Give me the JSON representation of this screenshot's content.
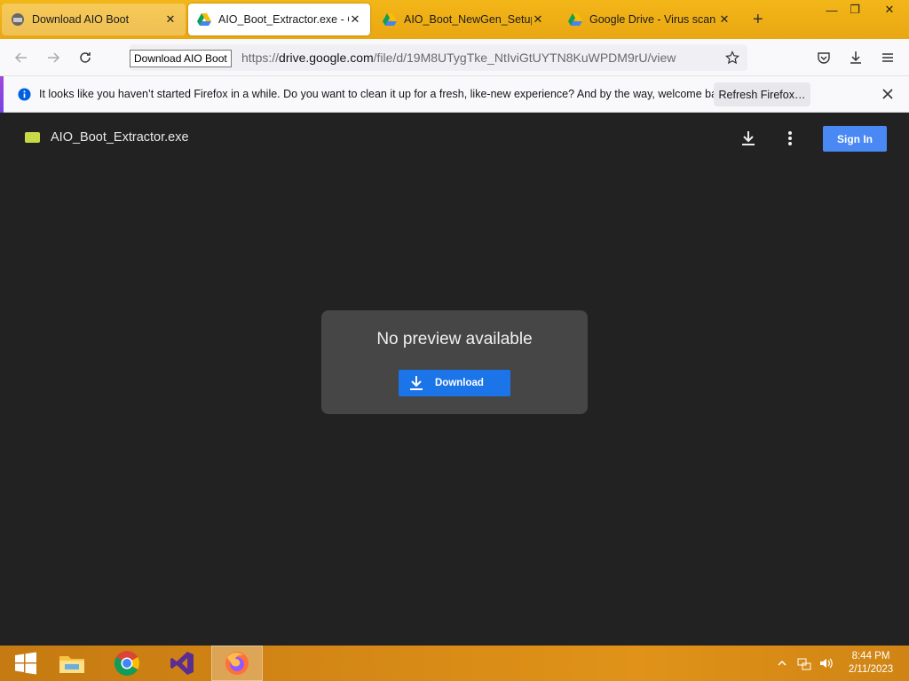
{
  "tabs": [
    {
      "label": "Download AIO Boot"
    },
    {
      "label": "AIO_Boot_Extractor.exe - Google Drive"
    },
    {
      "label": "AIO_Boot_NewGen_Setup.exe - Google Drive"
    },
    {
      "label": "Google Drive - Virus scan warning"
    }
  ],
  "tooltip": "Download AIO Boot",
  "url": {
    "prefix": "https://",
    "host": "drive.google.com",
    "path": "/file/d/19M8UTygTke_NtIviGtUYTN8KuWPDM9rU/view"
  },
  "notification": {
    "message": "It looks like you haven’t started Firefox in a while. Do you want to clean it up for a fresh, like-new experience? And by the way, welcome back!",
    "button": "Refresh Firefox…"
  },
  "viewer": {
    "filename": "AIO_Boot_Extractor.exe",
    "signin": "Sign In",
    "no_preview": "No preview available",
    "download": "Download"
  },
  "taskbar": {
    "time": "8:44 PM",
    "date": "2/11/2023"
  },
  "colors": {
    "tabstrip": "#f3b619",
    "signin": "#4a89f3",
    "download": "#1b74e8",
    "viewer_bg": "#222222"
  }
}
